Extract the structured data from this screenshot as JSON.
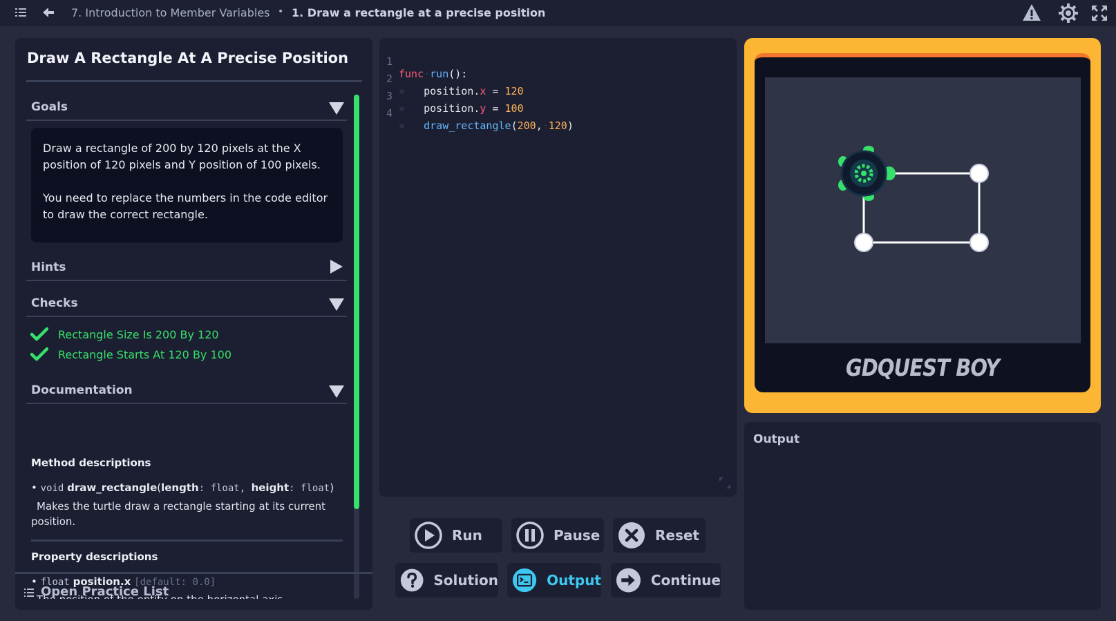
{
  "topbar": {
    "course": "7. Introduction to Member Variables",
    "separator": "•",
    "lesson": "1. Draw a rectangle at a precise position"
  },
  "left": {
    "title": "Draw A Rectangle At A Precise Position",
    "goals": {
      "label": "Goals",
      "p1": "Draw a rectangle of 200 by 120 pixels at the X position of 120 pixels and Y position of 100 pixels.",
      "p2": "You need to replace the numbers in the code editor to draw the correct rectangle."
    },
    "hints": {
      "label": "Hints"
    },
    "checks": {
      "label": "Checks",
      "items": [
        "Rectangle Size Is 200 By 120",
        "Rectangle Starts At 120 By 100"
      ],
      "color": "#37e06a"
    },
    "documentation": {
      "label": "Documentation",
      "method_heading": "Method descriptions",
      "method": {
        "bullet": "•",
        "return_type": "void",
        "name": "draw_rectangle",
        "open": "(",
        "p1_name": "length",
        "p1_type": "float",
        "p2_name": "height",
        "p2_type": "float",
        "close": ")",
        "description": "Makes the turtle draw a rectangle starting at its current position."
      },
      "property_heading": "Property descriptions",
      "property": {
        "bullet": "•",
        "type": "float",
        "name": "position.x",
        "default": "[default: 0.0]",
        "description": "The position of the entity on the horizontal axis."
      }
    },
    "open_practice": "Open Practice List"
  },
  "editor": {
    "lines": [
      {
        "n": "1",
        "k": "func",
        "fn": "run",
        "rest": "():"
      },
      {
        "n": "2",
        "obj": "position.",
        "axis": "x",
        "op": " = ",
        "num": "120"
      },
      {
        "n": "3",
        "obj": "position.",
        "axis": "y",
        "op": " = ",
        "num": "100"
      },
      {
        "n": "4",
        "call": "draw_rectangle",
        "args": [
          "200",
          "120"
        ]
      }
    ],
    "indent_marker": "»",
    "space_marker": "·"
  },
  "buttons": {
    "run": "Run",
    "pause": "Pause",
    "reset": "Reset",
    "solution": "Solution",
    "output": "Output",
    "continue": "Continue"
  },
  "preview": {
    "brand": "GDQUEST BOY",
    "frame_color": "#fdb633",
    "accent_color": "#f3762f"
  },
  "output": {
    "label": "Output"
  }
}
